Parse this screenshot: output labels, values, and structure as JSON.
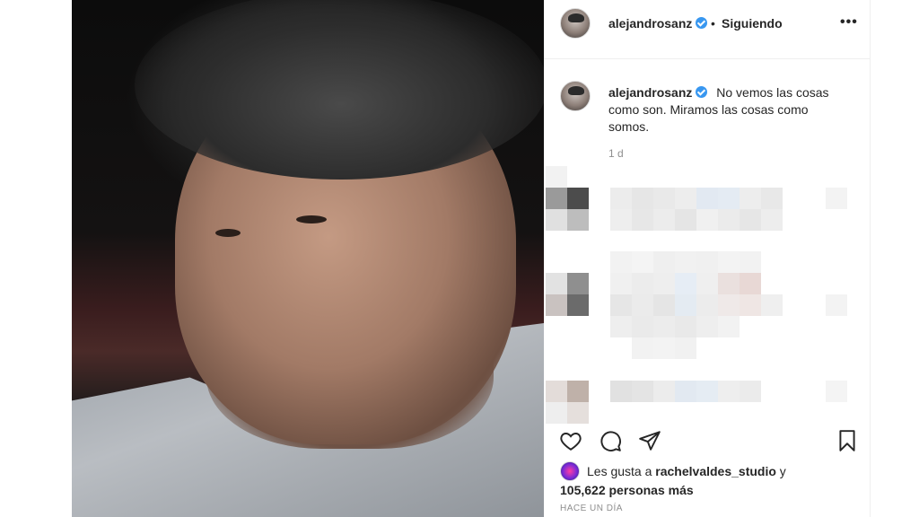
{
  "post": {
    "username": "alejandrosanz",
    "separator": "•",
    "follow_status": "Siguiendo",
    "more_label": "•••"
  },
  "caption": {
    "username": "alejandrosanz",
    "text": "No vemos las cosas como son. Miramos las cosas como somos.",
    "time": "1 d"
  },
  "likes": {
    "prefix": "Les gusta a",
    "liker": "rachelvaldes_studio",
    "conjunction": "y",
    "count_text": "105,622 personas más"
  },
  "posted_ago": "HACE UN DÍA",
  "icons": {
    "like": "heart-icon",
    "comment": "comment-icon",
    "share": "share-icon",
    "save": "bookmark-icon",
    "verified": "verified-badge-icon"
  },
  "colors": {
    "verified": "#3897f0",
    "text": "#262626",
    "muted": "#8e8e8e",
    "divider": "#efefef"
  }
}
